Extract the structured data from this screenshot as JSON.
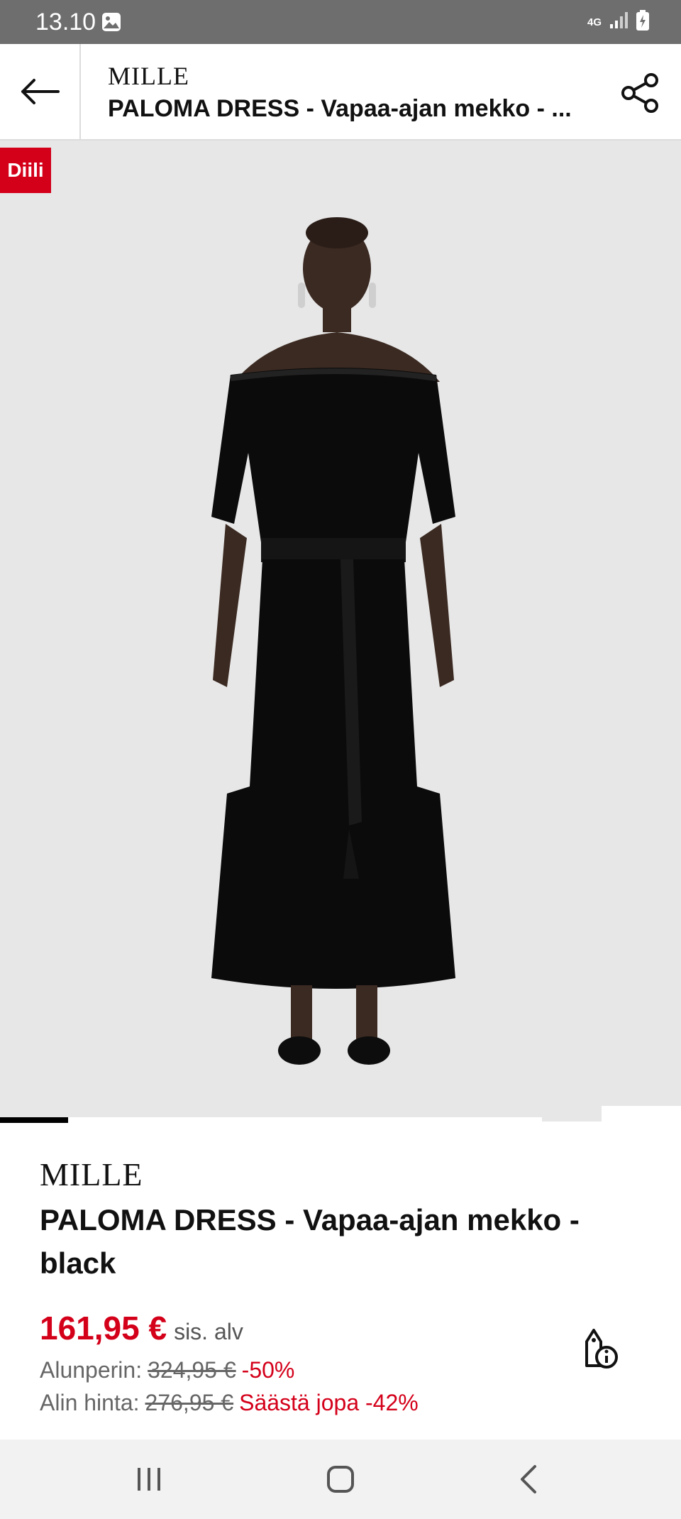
{
  "status_bar": {
    "time": "13.10",
    "network": "4G",
    "icons": [
      "image-notification-icon",
      "signal-icon",
      "battery-charging-icon"
    ]
  },
  "header": {
    "brand": "MILLE",
    "title": "PALOMA DRESS - Vapaa-ajan mekko - ...",
    "icons": [
      "back-arrow-icon",
      "share-icon"
    ]
  },
  "gallery": {
    "deal_badge": "Diili",
    "image_subject": "product-photo-black-off-shoulder-dress",
    "image_index": 1,
    "icons": [
      "ai-sparkle-icon",
      "bell-icon",
      "heart-icon"
    ]
  },
  "product": {
    "brand": "MILLE",
    "name": "PALOMA DRESS - Vapaa-ajan mekko - black",
    "price": "161,95 €",
    "vat_label": "sis. alv",
    "original_label": "Alunperin:",
    "original_price": "324,95 €",
    "discount": "-50%",
    "lowest_label": "Alin hinta:",
    "lowest_price": "276,95 €",
    "savings": "Säästä jopa -42%",
    "price_info_icon": "price-tag-info-icon"
  },
  "colors": {
    "accent": "#d4001a",
    "status_bar": "#6e6e6e",
    "image_background": "#e7e7e7",
    "nav_bar": "#f2f2f2"
  },
  "system_nav": {
    "icons": [
      "recents-icon",
      "home-icon",
      "back-icon"
    ]
  }
}
